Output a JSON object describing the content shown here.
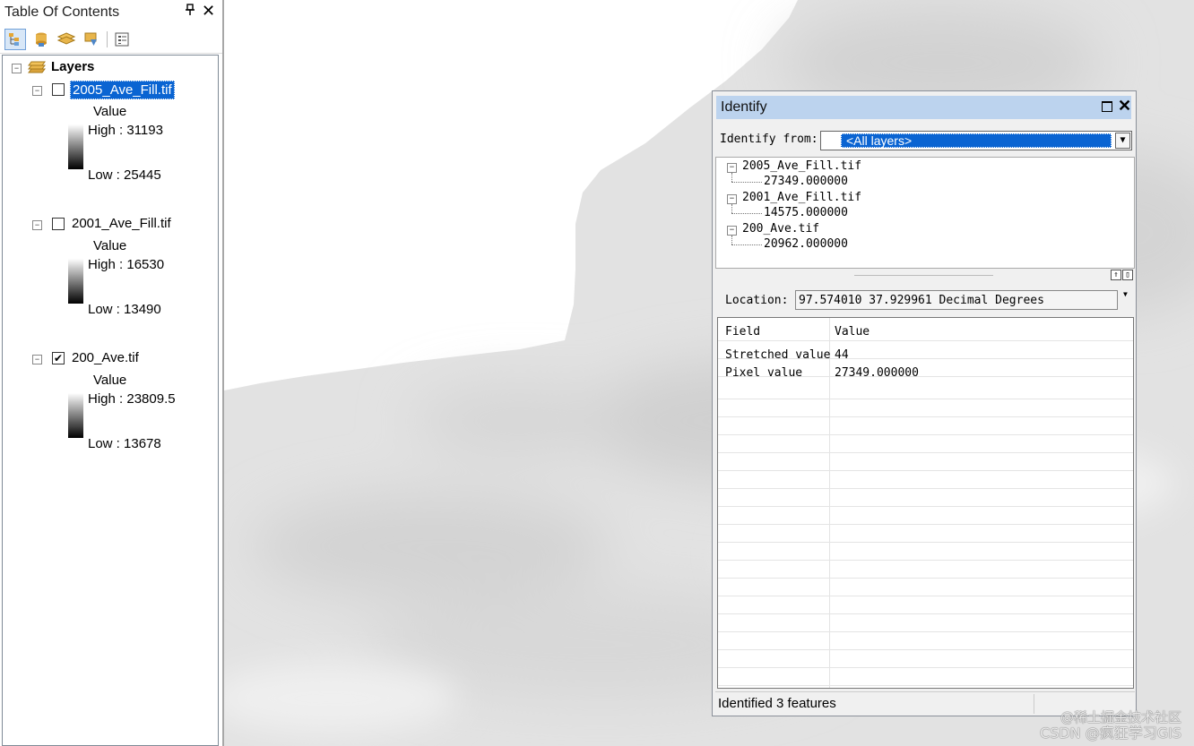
{
  "toc": {
    "title": "Table Of Contents",
    "root_label": "Layers",
    "layers": [
      {
        "name": "2005_Ave_Fill.tif",
        "checked": false,
        "selected": true,
        "field": "Value",
        "high": "High : 31193",
        "low": "Low : 25445"
      },
      {
        "name": "2001_Ave_Fill.tif",
        "checked": false,
        "selected": false,
        "field": "Value",
        "high": "High : 16530",
        "low": "Low : 13490"
      },
      {
        "name": "200_Ave.tif",
        "checked": true,
        "selected": false,
        "field": "Value",
        "high": "High : 23809.5",
        "low": "Low : 13678"
      }
    ]
  },
  "identify": {
    "title": "Identify",
    "from_label": "Identify from:",
    "from_value": "<All layers>",
    "results": [
      {
        "layer": "2005_Ave_Fill.tif",
        "value": "27349.000000"
      },
      {
        "layer": "2001_Ave_Fill.tif",
        "value": "14575.000000"
      },
      {
        "layer": "200_Ave.tif",
        "value": "20962.000000"
      }
    ],
    "location_label": "Location:",
    "location_value": "97.574010  37.929961 Decimal Degrees",
    "grid_headers": {
      "field": "Field",
      "value": "Value"
    },
    "grid_rows": [
      {
        "field": "Stretched value",
        "value": "44"
      },
      {
        "field": "Pixel value",
        "value": "27349.000000"
      }
    ],
    "status": "Identified 3 features"
  },
  "watermark": {
    "line1": "@稀土掘金技术社区",
    "line2": "CSDN @疯狂学习GIS"
  }
}
